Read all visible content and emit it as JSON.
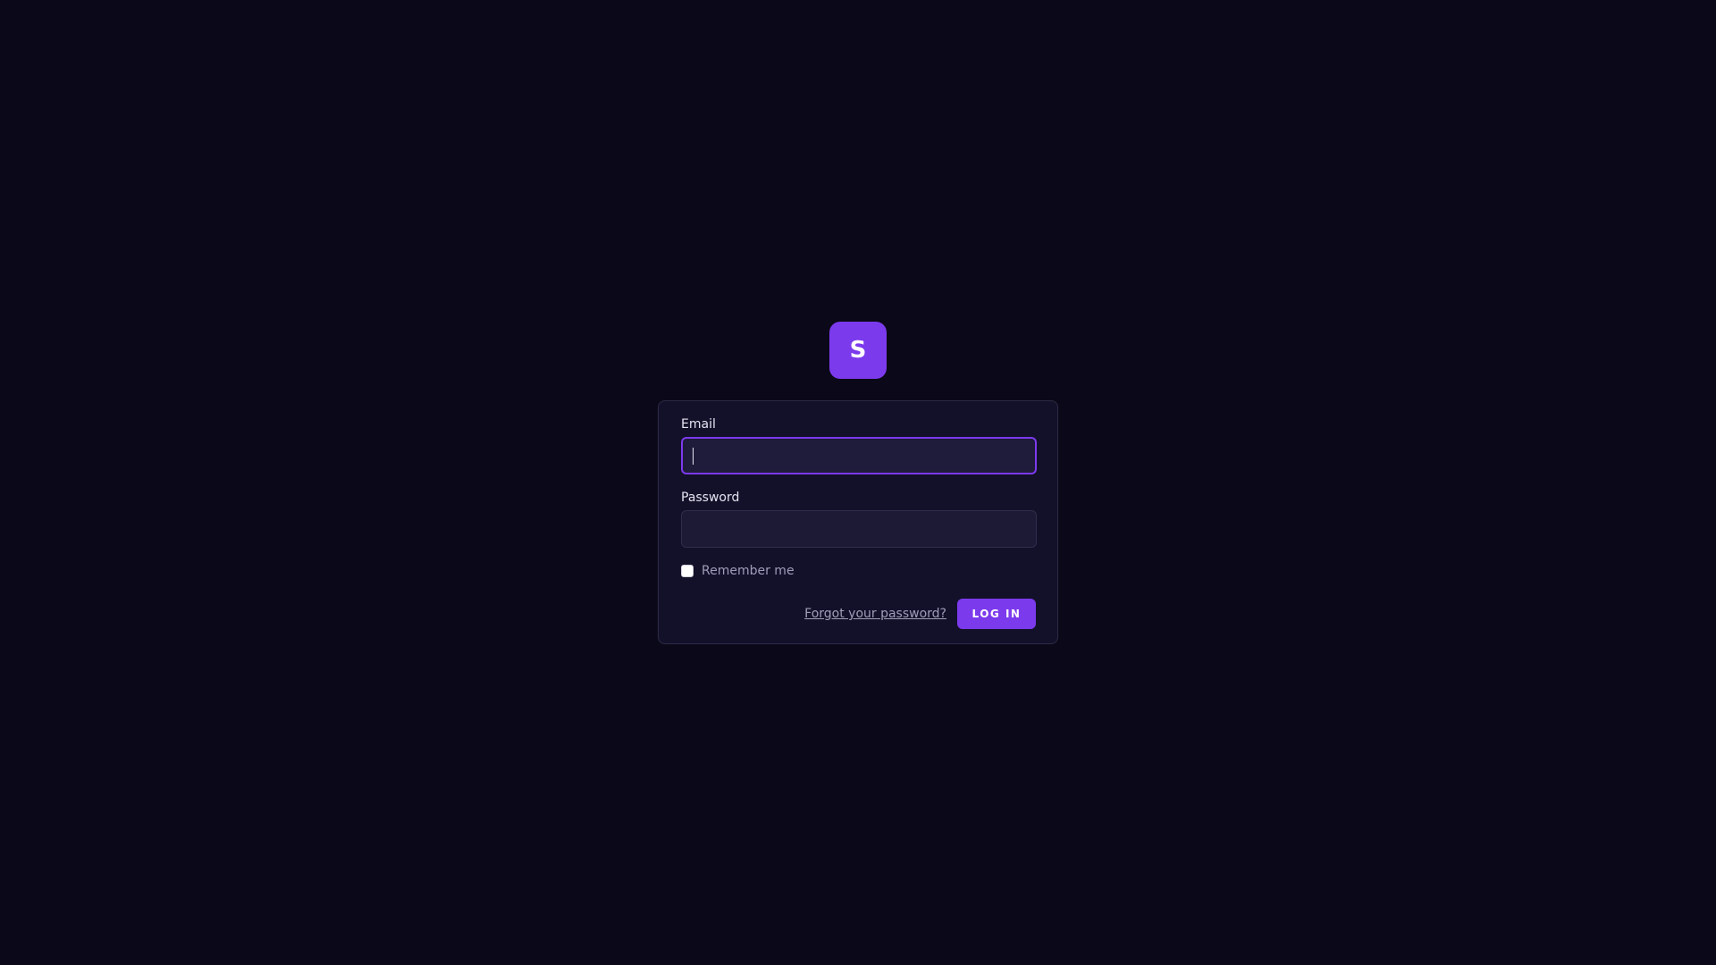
{
  "brand": {
    "logo_letter": "S",
    "accent_color": "#7c3aed"
  },
  "login_form": {
    "email_label": "Email",
    "email_value": "",
    "password_label": "Password",
    "password_value": "",
    "remember_label": "Remember me",
    "remember_checked": false,
    "forgot_link": "Forgot your password?",
    "submit_label": "LOG IN"
  },
  "colors": {
    "background": "#0b0919",
    "card": "#13112a",
    "input": "#1d1a36",
    "focus_border": "#7c3aed",
    "muted_text": "#a09db8"
  }
}
